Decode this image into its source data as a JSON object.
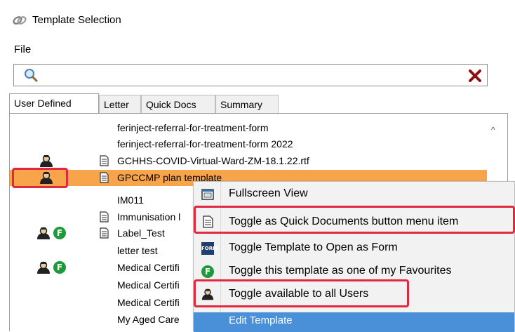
{
  "window": {
    "title": "Template Selection",
    "icon": "link-icon"
  },
  "menu": {
    "file": "File"
  },
  "search": {
    "value": "",
    "placeholder": ""
  },
  "tabs": [
    {
      "label": "User Defined",
      "active": true
    },
    {
      "label": "Letter",
      "active": false
    },
    {
      "label": "Quick Docs",
      "active": false
    },
    {
      "label": "Summary",
      "active": false
    }
  ],
  "list": {
    "rows": [
      {
        "label": "ferinject-referral-for-treatment-form"
      },
      {
        "label": "ferinject-referral-for-treatment-form 2022"
      },
      {
        "label": "GCHHS-COVID-Virtual-Ward-ZM-18.1.22.rtf"
      },
      {
        "label": "GPCCMP plan template"
      },
      {
        "label": "IM011"
      },
      {
        "label": "Immunisation l"
      },
      {
        "label": "Label_Test"
      },
      {
        "label": "letter test"
      },
      {
        "label": "Medical Certifi"
      },
      {
        "label": "Medical Certifi"
      },
      {
        "label": "Medical Certifi"
      },
      {
        "label": "My Aged Care"
      }
    ],
    "fav_letter": "F"
  },
  "context_menu": {
    "items": [
      {
        "label": "Fullscreen View",
        "icon": "fullscreen-icon"
      },
      {
        "label": "Toggle as Quick Documents button menu item",
        "icon": "document-icon"
      },
      {
        "label": "Toggle Template to Open as Form",
        "icon": "form-icon",
        "icon_text": "FORM"
      },
      {
        "label": "Toggle this template as one of my Favourites",
        "icon": "favourite-icon",
        "icon_text": "F"
      },
      {
        "label": "Toggle available to all Users",
        "icon": "users-icon"
      },
      {
        "label": "Edit Template",
        "icon": ""
      }
    ]
  },
  "colors": {
    "selection": "#f7a44a",
    "highlight": "#4a90d9",
    "annotation": "#e0283f",
    "favourite": "#1d9a3a"
  }
}
